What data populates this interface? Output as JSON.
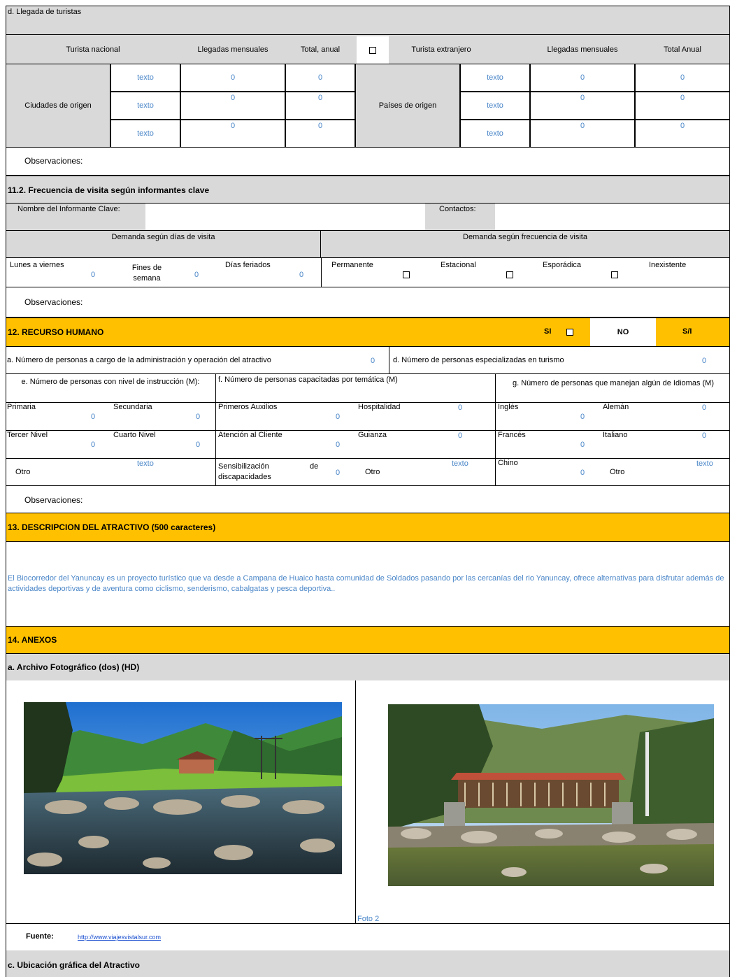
{
  "arrivals": {
    "title": "d. Llegada de turistas",
    "national": {
      "label": "Turista nacional",
      "monthly": "Llegadas mensuales",
      "annual": "Total, anual",
      "origin": "Ciudades de origen",
      "rows": [
        {
          "name": "texto",
          "monthly": "0",
          "annual": "0"
        },
        {
          "name": "texto",
          "monthly": "0",
          "annual": "0"
        },
        {
          "name": "texto",
          "monthly": "0",
          "annual": "0"
        }
      ]
    },
    "foreign": {
      "label": "Turista extranjero",
      "monthly": "Llegadas mensuales",
      "annual": "Total Anual",
      "origin": "Países de origen",
      "rows": [
        {
          "name": "texto",
          "monthly": "0",
          "annual": "0"
        },
        {
          "name": "texto",
          "monthly": "0",
          "annual": "0"
        },
        {
          "name": "texto",
          "monthly": "0",
          "annual": "0"
        }
      ]
    },
    "observations": "Observaciones:"
  },
  "frequency": {
    "title": "11.2. Frecuencia de visita según informantes clave",
    "informant_label": "Nombre del Informante Clave:",
    "contacts_label": "Contactos:",
    "days_header": "Demanda según días de visita",
    "freq_header": "Demanda según frecuencia de visita",
    "weekdays": {
      "label": "Lunes a viernes",
      "value": "0"
    },
    "weekends": {
      "label": "Fines de semana",
      "value": "0"
    },
    "holidays": {
      "label": "Días feriados",
      "value": "0"
    },
    "permanent": "Permanente",
    "seasonal": "Estacional",
    "sporadic": "Esporádica",
    "nonexistent": "Inexistente",
    "observations": "Observaciones:"
  },
  "human": {
    "title": "12. RECURSO HUMANO",
    "si": "SI",
    "no": "NO",
    "si_na": "S/I",
    "a_label": "a. Número de personas a cargo de la administración y operación del atractivo",
    "a_value": "0",
    "d_label": "d. Número de personas especializadas en turismo",
    "d_value": "0",
    "e_label": "e. Número de personas con nivel de instrucción (M):",
    "f_label": "f. Número de personas capacitadas por temática (M)",
    "g_label": "g. Número de personas que manejan algún de Idiomas (M)",
    "primaria": "Primaria",
    "secundaria": "Secundaria",
    "tercer": "Tercer Nivel",
    "cuarto": "Cuarto Nivel",
    "otro": "Otro",
    "primeros": "Primeros Auxilios",
    "hospitalidad": "Hospitalidad",
    "atencion": "Atención al Cliente",
    "guianza": "Guianza",
    "sensib1": "Sensibilización",
    "sensib_de": "de",
    "sensib2": "discapacidades",
    "ingles": "Inglés",
    "aleman": "Alemán",
    "frances": "Francés",
    "italiano": "Italiano",
    "chino": "Chino",
    "zero": "0",
    "texto": "texto",
    "observations": "Observaciones:"
  },
  "description": {
    "title": "13. DESCRIPCION DEL ATRACTIVO (500 caracteres)",
    "text": "El Biocorredor del Yanuncay es un proyecto turístico que va desde a Campana de Huaico hasta comunidad de Soldados pasando por las cercanías del rio Yanuncay, ofrece alternativas para disfrutar además de actividades deportivas y de aventura como ciclismo, senderismo, cabalgatas y pesca deportiva.."
  },
  "annexes": {
    "title": "14. ANEXOS",
    "photos_title": "a. Archivo Fotográfico (dos) (HD)",
    "photo2_caption": "Foto 2",
    "source_label": "Fuente:",
    "source_url": "http://www.viajesvistalsur.com",
    "location_title": "c. Ubicación gráfica del Atractivo"
  },
  "colors": {
    "gray": "#d9d9d9",
    "orange": "#ffc000",
    "blue_text": "#4a86c8"
  }
}
